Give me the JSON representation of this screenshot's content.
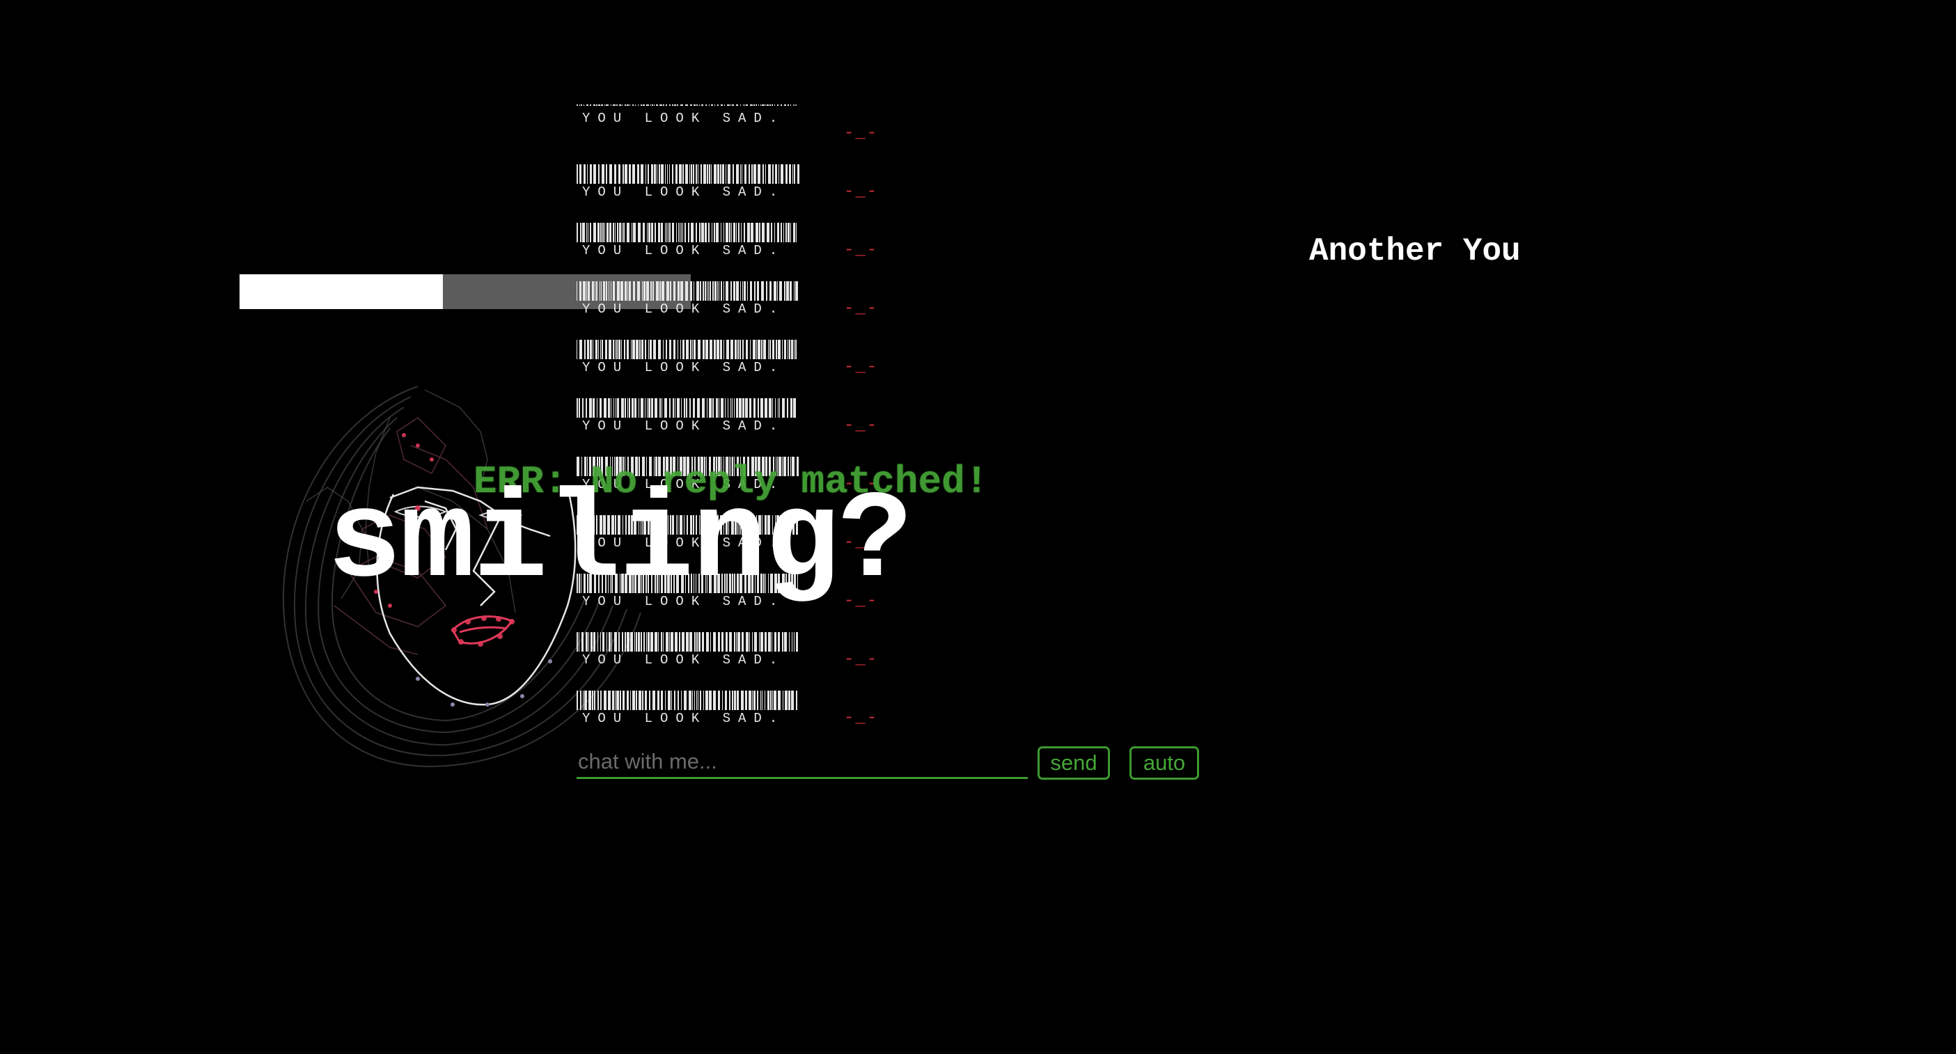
{
  "app": {
    "title": "Another You"
  },
  "status": {
    "error_message": "ERR: No reply matched!",
    "prompt_word": "smiling?",
    "progress_percent": 45
  },
  "barcode_feed": {
    "caption": "YOU LOOK SAD.",
    "rows": 11,
    "emoticon": "-_-"
  },
  "chat": {
    "input_placeholder": "chat with me...",
    "input_value": "",
    "send_label": "send",
    "auto_label": "auto"
  },
  "colors": {
    "accent_green": "#46a637",
    "emoticon_red": "#d3303a",
    "progress_fill": "#ffffff",
    "progress_track": "#5c5c5c",
    "background": "#000000"
  },
  "icons": {
    "face_mesh": "face-landmark-mesh-icon"
  }
}
